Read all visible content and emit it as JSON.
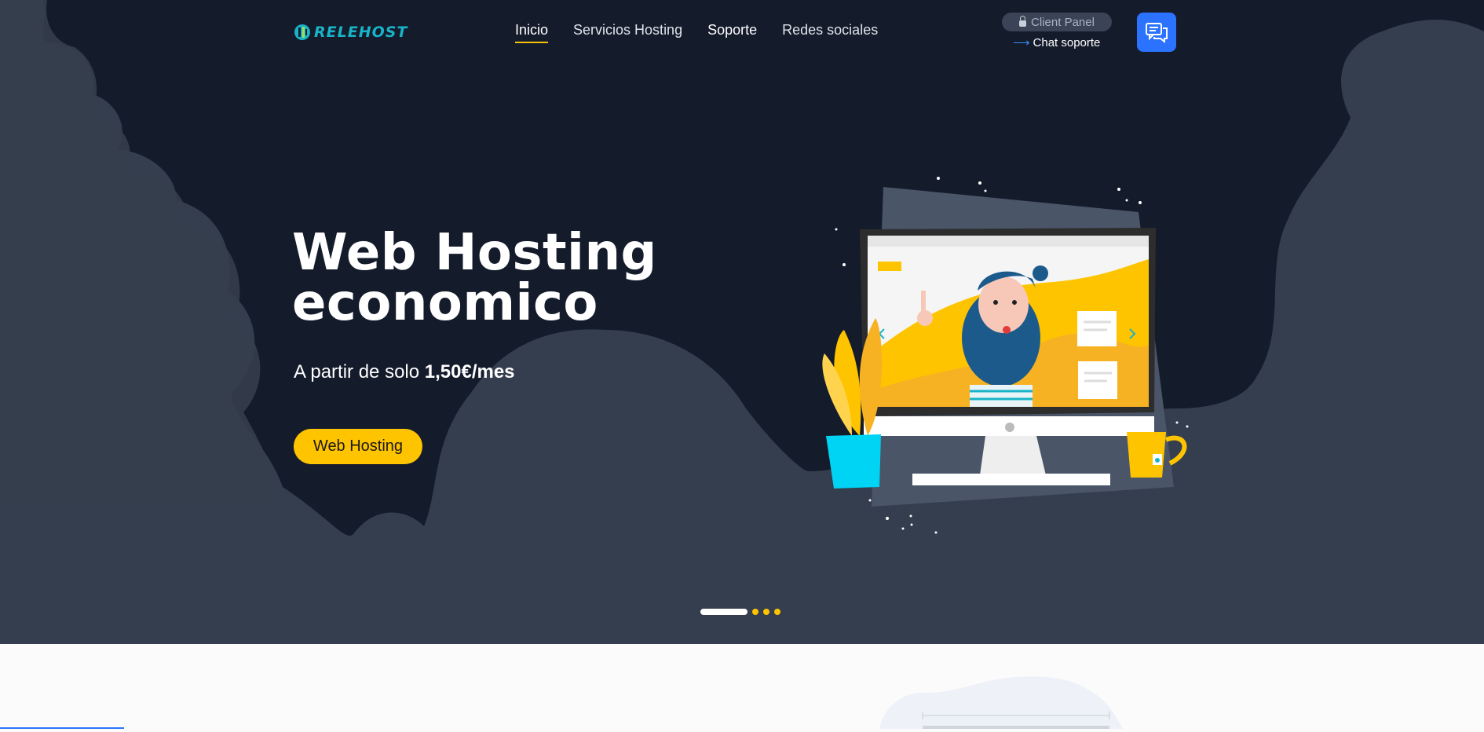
{
  "brand": {
    "logo_text": "RELEHOST"
  },
  "nav": {
    "items": [
      {
        "label": "Inicio",
        "active": true
      },
      {
        "label": "Servicios Hosting"
      },
      {
        "label": "Soporte"
      },
      {
        "label": "Redes sociales"
      }
    ]
  },
  "header": {
    "client_panel_label": "Client Panel",
    "chat_support_label": "Chat soporte",
    "chat_button_icon": "chat-bubbles-icon"
  },
  "hero": {
    "title_line1": "Web Hosting",
    "title_line2": "economico",
    "subtitle_prefix": "A partir de solo",
    "subtitle_price": "1,50€/mes",
    "cta_label": "Web Hosting",
    "illustration": "computer-monitor-illustration",
    "slider": {
      "total_slides": 4,
      "active_index": 0
    }
  },
  "colors": {
    "hero_bg": "#141b2b",
    "cloud": "#353e4e",
    "accent_yellow": "#ffc400",
    "chat_blue": "#2b73ff",
    "logo_teal": "#19b3c7"
  }
}
